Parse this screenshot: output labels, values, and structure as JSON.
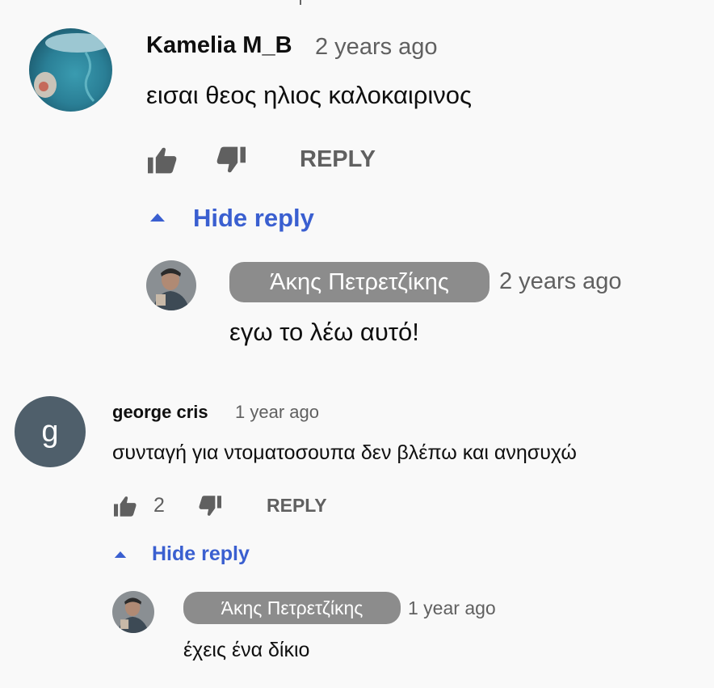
{
  "comments": [
    {
      "author": "Kamelia M_B",
      "time": "2 years ago",
      "text": "εισαι θεος ηλιος καλοκαιρινος",
      "like_count": "",
      "reply_label": "REPLY",
      "hide_reply_label": "Hide reply",
      "reply": {
        "author": "Άκης Πετρετζίκης",
        "time": "2 years ago",
        "text": "εγω το λέω αυτό!"
      }
    },
    {
      "author": "george cris",
      "avatar_letter": "g",
      "time": "1 year ago",
      "text": "συνταγή για ντοματοσουπα δεν βλέπω και ανησυχώ",
      "like_count": "2",
      "reply_label": "REPLY",
      "hide_reply_label": "Hide reply",
      "reply": {
        "author": "Άκης Πετρετζίκης",
        "time": "1 year ago",
        "text": "έχεις ένα δίκιο"
      }
    }
  ],
  "icons": [
    "thumb-up-icon",
    "thumb-down-icon",
    "caret-up-icon"
  ],
  "colors": {
    "link": "#3a5fd0",
    "chip": "#8c8c8c",
    "avatar_g": "#4f5f6b",
    "muted": "#606060"
  }
}
